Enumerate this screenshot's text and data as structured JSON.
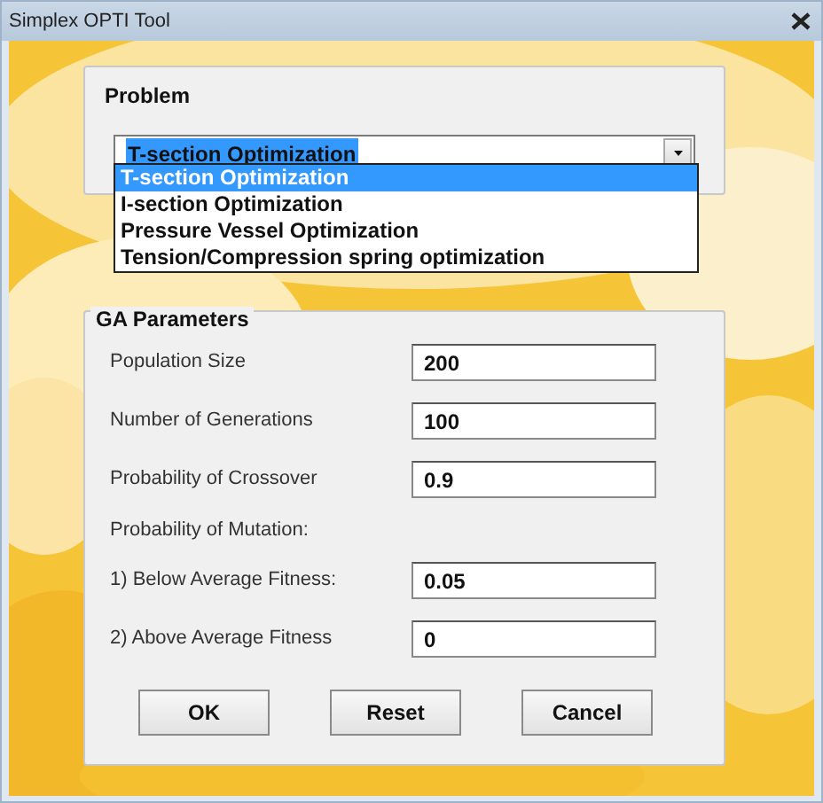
{
  "window": {
    "title": "Simplex OPTI Tool"
  },
  "problem": {
    "label": "Problem",
    "combo": {
      "value": "T-section Optimization",
      "expanded": true
    },
    "options": [
      {
        "label": "T-section Optimization",
        "selected": true
      },
      {
        "label": "I-section Optimization",
        "selected": false
      },
      {
        "label": "Pressure Vessel Optimization",
        "selected": false
      },
      {
        "label": "Tension/Compression spring optimization",
        "selected": false
      }
    ]
  },
  "ga_parameters": {
    "label": "GA Parameters",
    "rows": [
      {
        "kind": "field",
        "label": "Population Size",
        "value": "200"
      },
      {
        "kind": "field",
        "label": "Number of Generations",
        "value": "100"
      },
      {
        "kind": "field",
        "label": "Probability of Crossover",
        "value": "0.9"
      },
      {
        "kind": "heading",
        "label": "Probability of Mutation:"
      },
      {
        "kind": "field",
        "label": "1) Below Average Fitness:",
        "value": "0.05"
      },
      {
        "kind": "field",
        "label": "2) Above Average Fitness",
        "value": "0"
      }
    ]
  },
  "buttons": [
    "OK",
    "Reset",
    "Cancel"
  ]
}
